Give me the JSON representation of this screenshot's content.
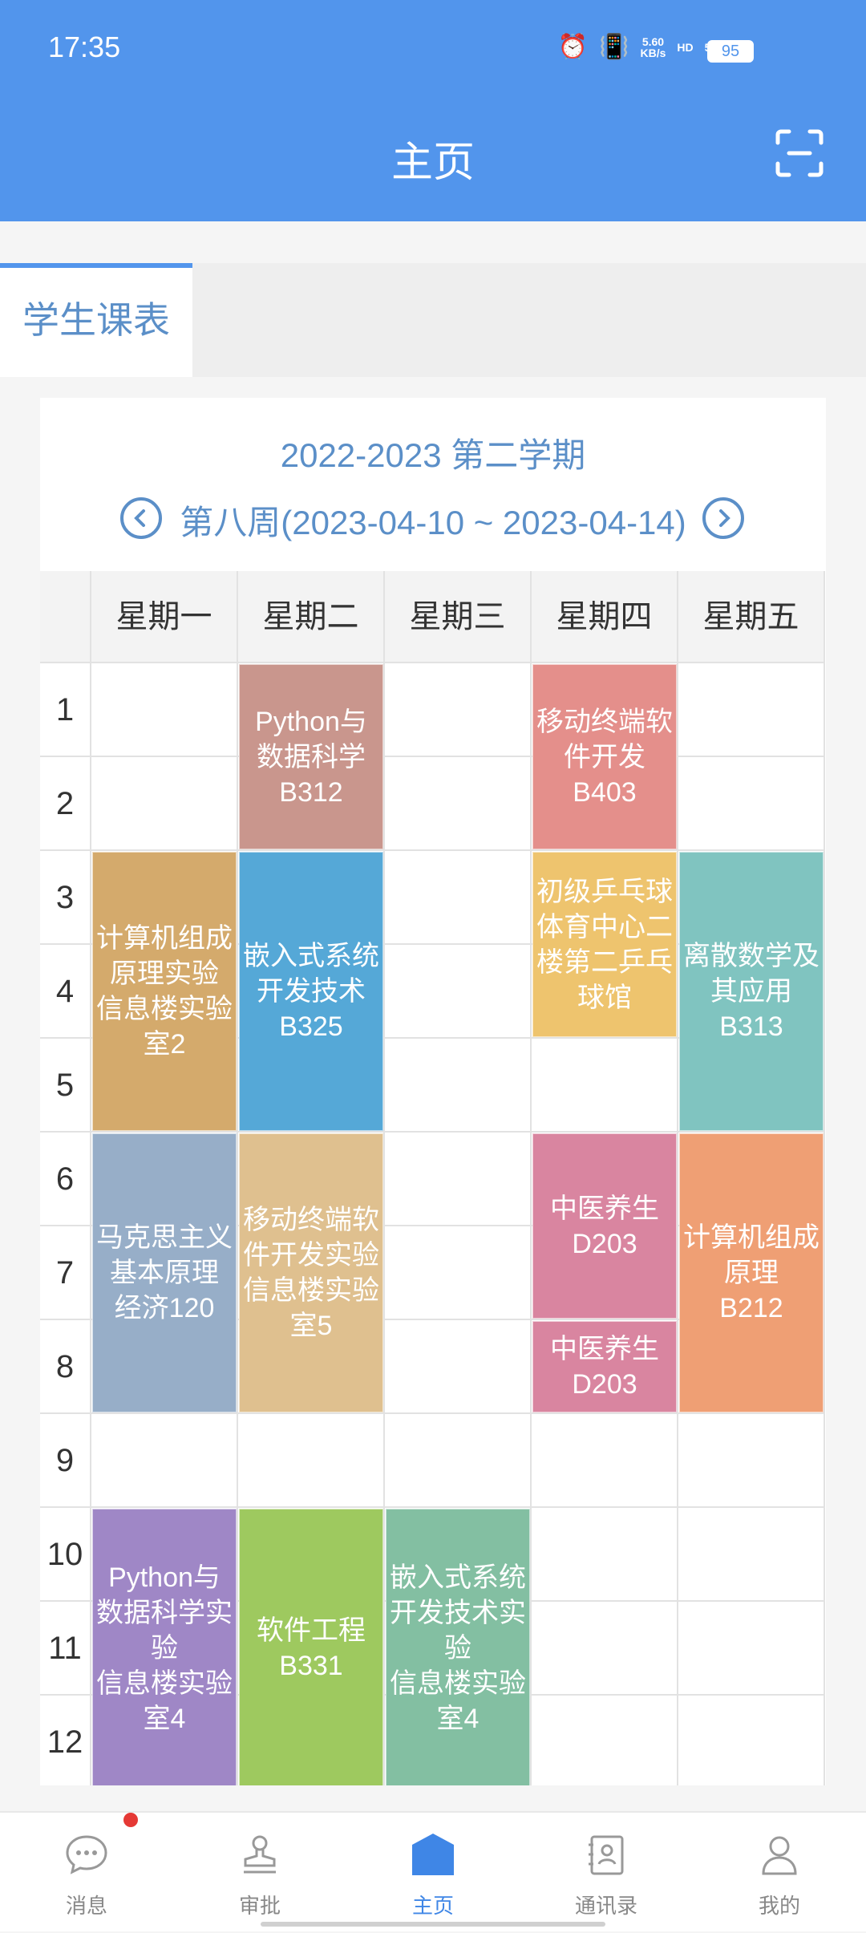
{
  "status": {
    "time": "17:35",
    "speed": "5.60\nKB/s",
    "net1": "5G",
    "net2": "4G",
    "battery": "95"
  },
  "header": {
    "title": "主页"
  },
  "tabs": [
    {
      "label": "学生课表"
    }
  ],
  "schedule": {
    "term": "2022-2023 第二学期",
    "week": "第八周(2023-04-10 ~ 2023-04-14)",
    "days": [
      "星期一",
      "星期二",
      "星期三",
      "星期四",
      "星期五"
    ],
    "periods": [
      "1",
      "2",
      "3",
      "4",
      "5",
      "6",
      "7",
      "8",
      "9",
      "10",
      "11",
      "12"
    ],
    "courses": [
      {
        "day": 1,
        "start": 1,
        "end": 2,
        "lines": [
          "Python与",
          "数据科学",
          "B312"
        ],
        "color": "#c9968d"
      },
      {
        "day": 3,
        "start": 1,
        "end": 2,
        "lines": [
          "移动终端软",
          "件开发",
          "B403"
        ],
        "color": "#e48f8b"
      },
      {
        "day": 0,
        "start": 3,
        "end": 5,
        "lines": [
          "计算机组成",
          "原理实验",
          "信息楼实验",
          "室2"
        ],
        "color": "#d4aa6c"
      },
      {
        "day": 1,
        "start": 3,
        "end": 5,
        "lines": [
          "嵌入式系统",
          "开发技术",
          "B325"
        ],
        "color": "#55a8d7"
      },
      {
        "day": 3,
        "start": 3,
        "end": 4,
        "lines": [
          "初级乒乓球",
          "体育中心二",
          "楼第二乒乓",
          "球馆"
        ],
        "color": "#eec46e"
      },
      {
        "day": 4,
        "start": 3,
        "end": 5,
        "lines": [
          "离散数学及",
          "其应用",
          "B313"
        ],
        "color": "#80c4c0"
      },
      {
        "day": 0,
        "start": 6,
        "end": 8,
        "lines": [
          "马克思主义",
          "基本原理",
          "经济120"
        ],
        "color": "#97aec8"
      },
      {
        "day": 1,
        "start": 6,
        "end": 8,
        "lines": [
          "移动终端软",
          "件开发实验",
          "信息楼实验",
          "室5"
        ],
        "color": "#dfc08f"
      },
      {
        "day": 3,
        "start": 6,
        "end": 7,
        "lines": [
          "中医养生",
          "D203"
        ],
        "color": "#d985a0"
      },
      {
        "day": 3,
        "start": 8,
        "end": 8,
        "lines": [
          "中医养生",
          "D203"
        ],
        "color": "#d985a0"
      },
      {
        "day": 4,
        "start": 6,
        "end": 8,
        "lines": [
          "计算机组成",
          "原理",
          "B212"
        ],
        "color": "#ef9f74"
      },
      {
        "day": 0,
        "start": 10,
        "end": 12,
        "lines": [
          "Python与",
          "数据科学实",
          "验",
          "信息楼实验",
          "室4"
        ],
        "color": "#9f87c6"
      },
      {
        "day": 1,
        "start": 10,
        "end": 12,
        "lines": [
          "软件工程",
          "B331"
        ],
        "color": "#9ec95f"
      },
      {
        "day": 2,
        "start": 10,
        "end": 12,
        "lines": [
          "嵌入式系统",
          "开发技术实",
          "验",
          "信息楼实验",
          "室4"
        ],
        "color": "#83bfa2"
      }
    ]
  },
  "nav": [
    {
      "label": "消息",
      "icon": "message-icon"
    },
    {
      "label": "审批",
      "icon": "stamp-icon"
    },
    {
      "label": "主页",
      "icon": "home-icon",
      "active": true
    },
    {
      "label": "通讯录",
      "icon": "contacts-icon"
    },
    {
      "label": "我的",
      "icon": "user-icon"
    }
  ],
  "colors": {
    "brand": "#5295ec",
    "accent_text": "#5b8fc8",
    "badge": "#e53935"
  }
}
